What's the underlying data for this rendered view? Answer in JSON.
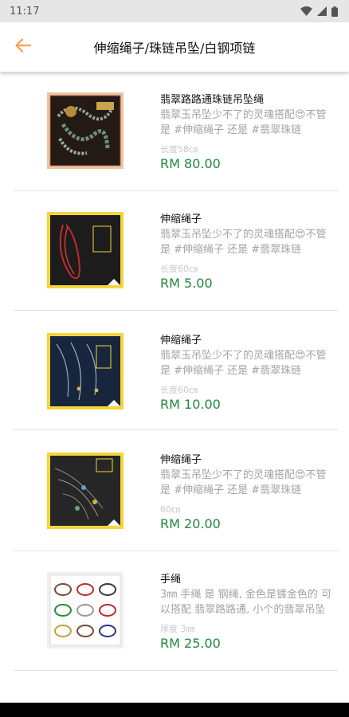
{
  "status_bar": {
    "time": "11:17",
    "icons": [
      "wifi-icon",
      "signal-icon",
      "battery-icon"
    ]
  },
  "header": {
    "title": "伸缩绳子/珠链吊坠/白钢项链",
    "back_icon": "arrow-left-icon",
    "accent_color": "#f5a14a"
  },
  "colors": {
    "price": "#1e8a3a",
    "description": "#a3a3a3",
    "divider": "#e2e2e2"
  },
  "products": [
    {
      "title": "翡翠路路通珠链吊坠绳",
      "description": "翡翠玉吊坠少不了的灵魂搭配😍不管是 #伸缩绳子 还是 #翡翠珠链",
      "extra": "长度58㎝",
      "price": "RM 80.00",
      "image": "jade-bead-chain-photo"
    },
    {
      "title": "伸缩绳子",
      "description": "翡翠玉吊坠少不了的灵魂搭配😍不管是 #伸缩绳子 还是 #翡翠珠链",
      "extra": "长度60㎝",
      "price": "RM 5.00",
      "image": "red-rope-photo"
    },
    {
      "title": "伸缩绳子",
      "description": "翡翠玉吊坠少不了的灵魂搭配😍不管是 #伸缩绳子 还是 #翡翠珠链",
      "extra": "长度60㎝",
      "price": "RM 10.00",
      "image": "blue-rope-photo"
    },
    {
      "title": "伸缩绳子",
      "description": "翡翠玉吊坠少不了的灵魂搭配😍不管是 #伸缩绳子 还是 #翡翠珠链",
      "extra": "60㎝",
      "price": "RM 20.00",
      "image": "dark-rope-photo"
    },
    {
      "title": "手绳",
      "description": "3㎜ 手绳 是 钢绳, 金色是镀金色的 可以搭配 翡翠路路通, 小个的翡翠吊坠",
      "extra": "厚度 3㎜",
      "price": "RM 25.00",
      "image": "bracelet-grid-photo"
    }
  ]
}
